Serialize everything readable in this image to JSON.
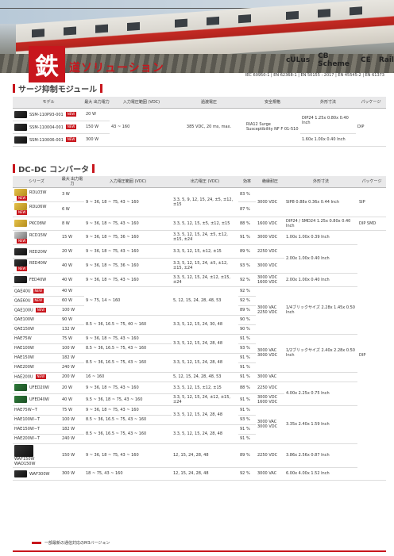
{
  "hero": {
    "logo": "鉄",
    "title": "道ソリューション"
  },
  "certs": [
    "cULus",
    "CB Scheme",
    "CE",
    "Rail"
  ],
  "standards": "IEC 60950-1 | EN 62368-1 | EN 50155 : 2017 | EN 45545-2 | EN 61373",
  "surge": {
    "title": "サージ抑制モジュール",
    "headers": [
      "モデル",
      "最大 出力電力",
      "入力電圧範囲 (VDC)",
      "過渡電圧",
      "安全規格",
      "外形寸法",
      "パッケージ"
    ],
    "rows": [
      {
        "model": "SSM-110P93-001",
        "new": "NEW",
        "power": "20 W"
      },
      {
        "model": "SSM-110004-001",
        "new": "NEW",
        "power": "150 W"
      },
      {
        "model": "SSM-110006-001",
        "new": "NEW",
        "power": "300 W"
      }
    ],
    "input": "43 ~ 160",
    "transient": "385 VDC, 20 ms, max.",
    "safety": "RIA12 Surge Susceptibility NF F 01-510",
    "dim1": "DIP24 1.25x 0.80x 0.40 Inch",
    "dim2": "1.60x 1.00x 0.40 Inch",
    "package": "DIP"
  },
  "dcdc": {
    "title": "DC-DC コンバータ",
    "headers": [
      "シリーズ",
      "最大 出力電力",
      "入力電圧範囲 (VDC)",
      "出力電圧 (VDC)",
      "効率",
      "絶縁耐圧",
      "外形寸法",
      "パッケージ"
    ],
    "rows": [
      {
        "series": "RDL03W",
        "new": "NEW",
        "power": "3 W",
        "eff": "83 %"
      },
      {
        "series": "RDL06W",
        "new": "NEW",
        "power": "6 W",
        "eff": "87 %"
      },
      {
        "series": "PKC08W",
        "new": "",
        "power": "8 W",
        "eff": "88 %"
      },
      {
        "series": "RCD15W",
        "new": "NEW",
        "power": "15 W",
        "eff": "91 %"
      },
      {
        "series": "RED20W",
        "new": "",
        "power": "20 W",
        "eff": "89 %"
      },
      {
        "series": "RED40W",
        "new": "NEW",
        "power": "40 W",
        "eff": "93 %"
      },
      {
        "series": "FED40W",
        "new": "",
        "power": "40 W",
        "eff": "92 %"
      },
      {
        "series": "QAE40U",
        "new": "NEW",
        "power": "40 W",
        "eff": "92 %"
      },
      {
        "series": "QAE60U",
        "new": "NEW",
        "power": "60 W",
        "eff": "92 %"
      },
      {
        "series": "QAE100U",
        "new": "NEW",
        "power": "100 W",
        "eff": "89 %"
      },
      {
        "series": "QAE100W",
        "new": "",
        "power": "90 W",
        "eff": "90 %"
      },
      {
        "series": "QAE150W",
        "new": "",
        "power": "132 W",
        "eff": "90 %"
      },
      {
        "series": "HAE75W",
        "new": "",
        "power": "75 W",
        "eff": "91 %"
      },
      {
        "series": "HAE100W",
        "new": "",
        "power": "100 W",
        "eff": "93 %"
      },
      {
        "series": "HAE150W",
        "new": "",
        "power": "182 W",
        "eff": "91 %"
      },
      {
        "series": "HAE200W",
        "new": "",
        "power": "240 W",
        "eff": "91 %"
      },
      {
        "series": "HAE200U",
        "new": "NEW",
        "power": "200 W",
        "eff": "91 %"
      },
      {
        "series": "UFED20W",
        "new": "",
        "power": "20 W",
        "eff": "88 %"
      },
      {
        "series": "UFED40W",
        "new": "",
        "power": "40 W",
        "eff": "91 %"
      },
      {
        "series": "HAE75W−T",
        "new": "",
        "power": "75 W",
        "eff": "91 %"
      },
      {
        "series": "HAE100W−T",
        "new": "",
        "power": "100 W",
        "eff": "93 %"
      },
      {
        "series": "HAE150W−T",
        "new": "",
        "power": "182 W",
        "eff": "91 %"
      },
      {
        "series": "HAE200W−T",
        "new": "",
        "power": "240 W",
        "eff": "91 %"
      },
      {
        "series": "WAF150W",
        "new": "",
        "power": "150 W",
        "eff": "89 %"
      },
      {
        "series": "WAD150W",
        "new": "",
        "power": "",
        "eff": ""
      },
      {
        "series": "WAF300W",
        "new": "",
        "power": "300 W",
        "eff": "92 %"
      }
    ],
    "cells": {
      "in_rdl": "9 ~ 36, 18 ~ 75, 43 ~ 160",
      "out_rdl": "3.3, 5, 9, 12, 15, 24, ±5, ±12, ±15",
      "iso_rdl": "3000 VDC",
      "dim_rdl": "SIP8 0.88x 0.36x 0.44 Inch",
      "pkg_rdl": "SIP",
      "in_pkc": "9 ~ 36, 18 ~ 75, 43 ~ 160",
      "out_pkc": "3.3, 5, 12, 15, ±5, ±12, ±15",
      "iso_pkc": "1600 VDC",
      "dim_pkc": "DIP24 / SMD24 1.25x 0.80x 0.40 Inch",
      "pkg_pkc": "DIP SMD",
      "in_rcd": "9 ~ 36, 18 ~ 75, 36 ~ 160",
      "out_rcd": "3.3, 5, 12, 15, 24, ±5, ±12, ±15, ±24",
      "iso_rcd": "3000 VDC",
      "dim_rcd": "1.00x 1.00x 0.39 Inch",
      "in_red20": "9 ~ 36, 18 ~ 75, 43 ~ 160",
      "out_red20": "3.3, 5, 12, 15, ±12, ±15",
      "iso_red20": "2250 VDC",
      "in_red40": "9 ~ 36, 18 ~ 75, 36 ~ 160",
      "out_red40": "3.3, 5, 12, 15, 24, ±5, ±12, ±15, ±24",
      "iso_red40": "3000 VDC",
      "dim_red": "2.00x 1.00x 0.40 Inch",
      "in_fed": "9 ~ 36, 18 ~ 75, 43 ~ 160",
      "out_fed": "3.3, 5, 12, 15, 24, ±12, ±15, ±24",
      "iso_fed": "3000 VDC 1600 VDC",
      "dim_fed": "2.00x 1.00x 0.40 Inch",
      "in_qaeu": "9 ~ 75, 14 ~ 160",
      "out_qaeu": "5, 12, 15, 24, 28, 48, 53",
      "in_qaew": "8.5 ~ 36, 16.5 ~ 75, 40 ~ 160",
      "out_qaew": "3.3, 5, 12, 15, 24, 30, 48",
      "iso_qae": "3000 VAC 2250 VDC",
      "dim_qae": "1/4ブリックサイズ 2.28x 1.45x 0.50 Inch",
      "pkg_qae": "DIP",
      "in_hae75": "9 ~ 36, 18 ~ 75, 43 ~ 160",
      "in_hae100": "8.5 ~ 36, 16.5 ~ 75, 43 ~ 160",
      "out_hae1": "3.3, 5, 12, 15, 24, 28, 48",
      "in_hae150": "8.5 ~ 36, 16.5 ~ 75, 43 ~ 160",
      "out_hae2": "3.3, 5, 12, 15, 24, 28, 48",
      "iso_hae": "3000 VAC 3000 VDC",
      "dim_hae": "1/2ブリックサイズ 2.40x 2.28x 0.50 Inch",
      "in_hae200u": "16 ~ 160",
      "out_hae200u": "5, 12, 15, 24, 28, 48, 53",
      "iso_hae200u": "3000 VAC",
      "in_ufed20": "9 ~ 36, 18 ~ 75, 43 ~ 160",
      "out_ufed20": "3.3, 5, 12, 15, ±12, ±15",
      "iso_ufed20": "2250 VDC",
      "in_ufed40": "9.5 ~ 36, 18 ~ 75, 43 ~ 160",
      "out_ufed40": "3.3, 5, 12, 15, 24, ±12, ±15, ±24",
      "iso_ufed40": "3000 VDC 1600 VDC",
      "dim_ufed": "4.00x 2.25x 0.75 Inch",
      "pkg_ufed": "シャーシ DINレール",
      "in_haet75": "9 ~ 36, 18 ~ 75, 43 ~ 160",
      "in_haet100": "8.5 ~ 36, 16.5 ~ 75, 43 ~ 160",
      "out_haet1": "3.3, 5, 12, 15, 24, 28, 48",
      "in_haet150": "8.5 ~ 36, 16.5 ~ 75, 43 ~ 160",
      "out_haet2": "3.3, 5, 12, 15, 24, 28, 48",
      "iso_haet": "3000 VAC 3000 VDC",
      "dim_haet": "3.35x 2.40x 1.59 Inch",
      "pkg_haet": "シャーシ",
      "in_waf": "9 ~ 36, 18 ~ 75, 43 ~ 160",
      "out_waf": "12, 15, 24, 28, 48",
      "iso_waf": "2250 VDC",
      "dim_waf": "3.86x 2.56x 0.87 Inch",
      "pkg_waf": "シャーシ",
      "in_waf300": "18 ~ 75, 43 ~ 160",
      "out_waf300": "12, 15, 24, 28, 48",
      "iso_waf300": "3000 VAC",
      "dim_waf300": "6.00x 4.00x 1.52 Inch",
      "pkg_waf300": "シャーシ DINレール"
    }
  },
  "footnote": "一部最新の通信対応のM3バージョン"
}
